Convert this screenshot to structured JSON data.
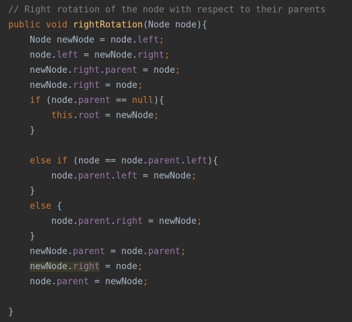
{
  "editor": {
    "language": "Java",
    "background": "#2b2b2b",
    "colors": {
      "comment": "#808080",
      "keyword": "#cc7832",
      "method": "#ffc66d",
      "field": "#9876aa",
      "text": "#a9b7c6",
      "highlight": "#3b3b2c"
    },
    "lines": [
      [
        {
          "t": "// Right rotation of the node with respect to their parents",
          "c": "comment"
        }
      ],
      [
        {
          "t": "public ",
          "c": "keyword"
        },
        {
          "t": "void ",
          "c": "keyword"
        },
        {
          "t": "rightRotation",
          "c": "method"
        },
        {
          "t": "(Node node){",
          "c": "text"
        }
      ],
      [
        {
          "t": "    Node newNode = node.",
          "c": "text"
        },
        {
          "t": "left",
          "c": "field"
        },
        {
          "t": ";",
          "c": "semi"
        }
      ],
      [
        {
          "t": "    node.",
          "c": "text"
        },
        {
          "t": "left",
          "c": "field"
        },
        {
          "t": " = newNode.",
          "c": "text"
        },
        {
          "t": "right",
          "c": "field"
        },
        {
          "t": ";",
          "c": "semi"
        }
      ],
      [
        {
          "t": "    newNode.",
          "c": "text"
        },
        {
          "t": "right",
          "c": "field"
        },
        {
          "t": ".",
          "c": "text"
        },
        {
          "t": "parent",
          "c": "field"
        },
        {
          "t": " = node",
          "c": "text"
        },
        {
          "t": ";",
          "c": "semi"
        }
      ],
      [
        {
          "t": "    newNode.",
          "c": "text"
        },
        {
          "t": "right",
          "c": "field"
        },
        {
          "t": " = node",
          "c": "text"
        },
        {
          "t": ";",
          "c": "semi"
        }
      ],
      [
        {
          "t": "    ",
          "c": "text"
        },
        {
          "t": "if ",
          "c": "keyword"
        },
        {
          "t": "(node.",
          "c": "text"
        },
        {
          "t": "parent",
          "c": "field"
        },
        {
          "t": " == ",
          "c": "text"
        },
        {
          "t": "null",
          "c": "keyword"
        },
        {
          "t": "){",
          "c": "text"
        }
      ],
      [
        {
          "t": "        ",
          "c": "text"
        },
        {
          "t": "this",
          "c": "keyword"
        },
        {
          "t": ".",
          "c": "text"
        },
        {
          "t": "root",
          "c": "field"
        },
        {
          "t": " = newNode",
          "c": "text"
        },
        {
          "t": ";",
          "c": "semi"
        }
      ],
      [
        {
          "t": "    }",
          "c": "text"
        }
      ],
      [],
      [
        {
          "t": "    ",
          "c": "text"
        },
        {
          "t": "else ",
          "c": "keyword"
        },
        {
          "t": "if ",
          "c": "keyword"
        },
        {
          "t": "(node == node.",
          "c": "text"
        },
        {
          "t": "parent",
          "c": "field"
        },
        {
          "t": ".",
          "c": "text"
        },
        {
          "t": "left",
          "c": "field"
        },
        {
          "t": "){",
          "c": "text"
        }
      ],
      [
        {
          "t": "        node.",
          "c": "text"
        },
        {
          "t": "parent",
          "c": "field"
        },
        {
          "t": ".",
          "c": "text"
        },
        {
          "t": "left",
          "c": "field"
        },
        {
          "t": " = newNode",
          "c": "text"
        },
        {
          "t": ";",
          "c": "semi"
        }
      ],
      [
        {
          "t": "    }",
          "c": "text"
        }
      ],
      [
        {
          "t": "    ",
          "c": "text"
        },
        {
          "t": "else ",
          "c": "keyword"
        },
        {
          "t": "{",
          "c": "text"
        }
      ],
      [
        {
          "t": "        node.",
          "c": "text"
        },
        {
          "t": "parent",
          "c": "field"
        },
        {
          "t": ".",
          "c": "text"
        },
        {
          "t": "right",
          "c": "field"
        },
        {
          "t": " = newNode",
          "c": "text"
        },
        {
          "t": ";",
          "c": "semi"
        }
      ],
      [
        {
          "t": "    }",
          "c": "text"
        }
      ],
      [
        {
          "t": "    newNode.",
          "c": "text"
        },
        {
          "t": "parent",
          "c": "field"
        },
        {
          "t": " = node.",
          "c": "text"
        },
        {
          "t": "parent",
          "c": "field"
        },
        {
          "t": ";",
          "c": "semi"
        }
      ],
      [
        {
          "t": "    ",
          "c": "text"
        },
        {
          "t": "newNode.",
          "c": "text",
          "hl": true
        },
        {
          "t": "right",
          "c": "field",
          "hl": true
        },
        {
          "t": " = node",
          "c": "text"
        },
        {
          "t": ";",
          "c": "semi"
        }
      ],
      [
        {
          "t": "    node.",
          "c": "text"
        },
        {
          "t": "parent",
          "c": "field"
        },
        {
          "t": " = newNode",
          "c": "text"
        },
        {
          "t": ";",
          "c": "semi"
        }
      ],
      [],
      [
        {
          "t": "}",
          "c": "text"
        }
      ]
    ]
  }
}
